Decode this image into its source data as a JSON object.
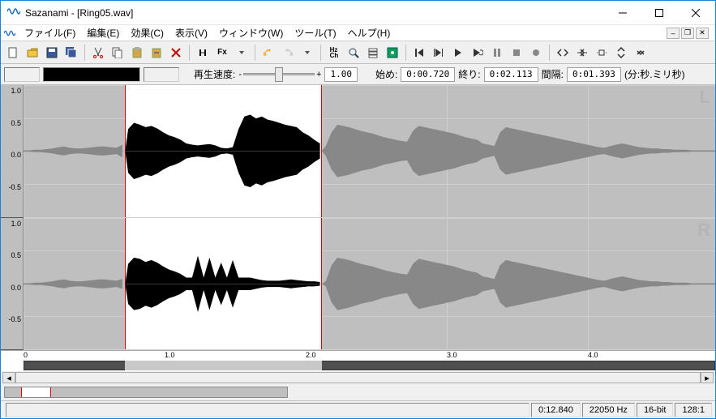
{
  "window": {
    "title": "Sazanami - [Ring05.wav]"
  },
  "menu": {
    "file": "ファイル(F)",
    "edit": "編集(E)",
    "effect": "効果(C)",
    "view": "表示(V)",
    "window": "ウィンドウ(W)",
    "tool": "ツール(T)",
    "help": "ヘルプ(H)"
  },
  "infobar": {
    "playback_speed_label": "再生速度:",
    "speed_minus": "-",
    "speed_plus": "+",
    "speed_value": "1.00",
    "start_label": "始め:",
    "start_value": "0:00.720",
    "end_label": "終り:",
    "end_value": "0:02.113",
    "interval_label": "間隔:",
    "interval_value": "0:01.393",
    "time_unit": "(分:秒.ミリ秒)"
  },
  "waveform": {
    "channel_left": "L",
    "channel_right": "R",
    "y_ticks": [
      "1.0",
      "0.5",
      "0.0",
      "-0.5",
      ""
    ],
    "x_ticks": [
      {
        "label": "0",
        "pct": 0
      },
      {
        "label": "1.0",
        "pct": 20.4
      },
      {
        "label": "2.0",
        "pct": 40.8
      },
      {
        "label": "3.0",
        "pct": 61.2
      },
      {
        "label": "4.0",
        "pct": 81.6
      }
    ],
    "selection_start_pct": 14.7,
    "selection_end_pct": 43.1
  },
  "status": {
    "total_time": "0:12.840",
    "sample_rate": "22050 Hz",
    "bit_depth": "16-bit",
    "zoom": "128:1"
  },
  "chart_data": {
    "type": "waveform",
    "channels": 2,
    "sample_rate": 22050,
    "bit_depth": 16,
    "duration_sec": 12.84,
    "visible_range_sec": [
      0,
      4.9
    ],
    "selection_sec": [
      0.72,
      2.113
    ],
    "y_range": [
      -1.0,
      1.0
    ],
    "envelope_sample_count": 120,
    "left_envelope_abs": [
      0.01,
      0.01,
      0.02,
      0.02,
      0.03,
      0.04,
      0.06,
      0.07,
      0.05,
      0.04,
      0.04,
      0.05,
      0.06,
      0.07,
      0.07,
      0.06,
      0.05,
      0.1,
      0.35,
      0.45,
      0.42,
      0.38,
      0.4,
      0.36,
      0.3,
      0.25,
      0.22,
      0.18,
      0.12,
      0.1,
      0.09,
      0.1,
      0.11,
      0.09,
      0.05,
      0.04,
      0.06,
      0.35,
      0.55,
      0.58,
      0.52,
      0.55,
      0.5,
      0.48,
      0.45,
      0.42,
      0.4,
      0.38,
      0.3,
      0.25,
      0.18,
      0.12,
      0.08,
      0.3,
      0.42,
      0.4,
      0.38,
      0.35,
      0.32,
      0.3,
      0.28,
      0.25,
      0.22,
      0.2,
      0.18,
      0.16,
      0.15,
      0.32,
      0.4,
      0.38,
      0.36,
      0.34,
      0.32,
      0.3,
      0.28,
      0.25,
      0.22,
      0.2,
      0.18,
      0.12,
      0.1,
      0.08,
      0.3,
      0.38,
      0.36,
      0.34,
      0.32,
      0.3,
      0.28,
      0.26,
      0.24,
      0.22,
      0.2,
      0.18,
      0.16,
      0.14,
      0.12,
      0.1,
      0.08,
      0.06,
      0.05,
      0.08,
      0.1,
      0.12,
      0.1,
      0.08,
      0.06,
      0.05,
      0.04,
      0.04,
      0.03,
      0.03,
      0.02,
      0.02,
      0.02,
      0.01,
      0.01,
      0.01,
      0.01,
      0.01
    ],
    "right_envelope_abs": [
      0.01,
      0.01,
      0.02,
      0.02,
      0.03,
      0.04,
      0.06,
      0.07,
      0.05,
      0.04,
      0.04,
      0.05,
      0.06,
      0.07,
      0.07,
      0.06,
      0.05,
      0.08,
      0.32,
      0.42,
      0.4,
      0.35,
      0.38,
      0.34,
      0.28,
      0.23,
      0.2,
      0.16,
      0.1,
      0.1,
      0.45,
      0.1,
      0.42,
      0.1,
      0.34,
      0.1,
      0.38,
      0.1,
      0.1,
      0.1,
      0.08,
      0.06,
      0.05,
      0.05,
      0.05,
      0.06,
      0.07,
      0.06,
      0.05,
      0.04,
      0.04,
      0.03,
      0.04,
      0.3,
      0.42,
      0.4,
      0.38,
      0.35,
      0.32,
      0.3,
      0.28,
      0.25,
      0.22,
      0.2,
      0.18,
      0.16,
      0.15,
      0.32,
      0.4,
      0.38,
      0.36,
      0.34,
      0.32,
      0.3,
      0.28,
      0.25,
      0.22,
      0.2,
      0.18,
      0.12,
      0.1,
      0.08,
      0.3,
      0.38,
      0.36,
      0.34,
      0.32,
      0.3,
      0.28,
      0.26,
      0.24,
      0.22,
      0.2,
      0.18,
      0.16,
      0.14,
      0.12,
      0.1,
      0.08,
      0.06,
      0.05,
      0.08,
      0.1,
      0.12,
      0.1,
      0.08,
      0.06,
      0.05,
      0.04,
      0.04,
      0.03,
      0.03,
      0.02,
      0.02,
      0.02,
      0.01,
      0.01,
      0.01,
      0.01,
      0.01
    ]
  }
}
